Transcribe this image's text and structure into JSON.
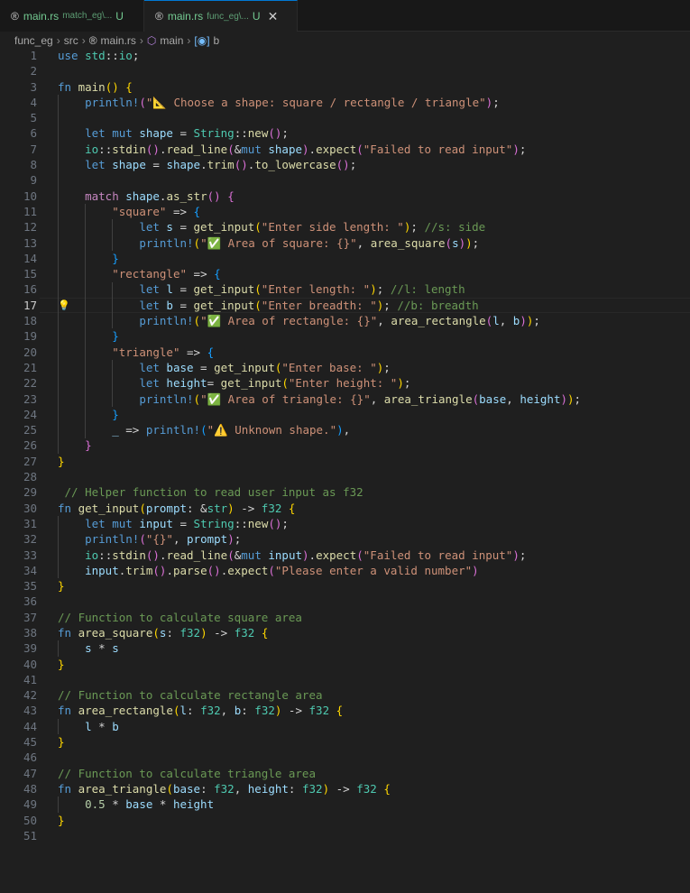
{
  "tabs": [
    {
      "icon": "rust-icon",
      "name": "main.rs",
      "desc": "match_eg\\...",
      "status": "U"
    },
    {
      "icon": "rust-icon",
      "name": "main.rs",
      "desc": "func_eg\\...",
      "status": "U",
      "close": "✕"
    }
  ],
  "breadcrumb": [
    "func_eg",
    "src",
    "main.rs",
    "main",
    "b"
  ],
  "current_line": 17,
  "code": [
    {
      "n": "1",
      "segs": [
        [
          "kw",
          "use "
        ],
        [
          "ty",
          "std"
        ],
        [
          "pl",
          "::"
        ],
        [
          "ty",
          "io"
        ],
        [
          "pl",
          ";"
        ]
      ]
    },
    {
      "n": "2",
      "segs": []
    },
    {
      "n": "3",
      "segs": [
        [
          "kw",
          "fn "
        ],
        [
          "fn",
          "main"
        ],
        [
          "br1",
          "()"
        ],
        [
          "pl",
          " "
        ],
        [
          "br1",
          "{"
        ]
      ]
    },
    {
      "n": "4",
      "segs": [
        [
          "pl",
          "    "
        ],
        [
          "mac",
          "println!"
        ],
        [
          "br2",
          "("
        ],
        [
          "str",
          "\"📐 Choose a shape: square / rectangle / triangle\""
        ],
        [
          "br2",
          ")"
        ],
        [
          "pl",
          ";"
        ]
      ]
    },
    {
      "n": "5",
      "segs": []
    },
    {
      "n": "6",
      "segs": [
        [
          "pl",
          "    "
        ],
        [
          "kw",
          "let mut "
        ],
        [
          "var",
          "shape"
        ],
        [
          "pl",
          " = "
        ],
        [
          "ty",
          "String"
        ],
        [
          "pl",
          "::"
        ],
        [
          "fn",
          "new"
        ],
        [
          "br2",
          "()"
        ],
        [
          "pl",
          ";"
        ]
      ]
    },
    {
      "n": "7",
      "segs": [
        [
          "pl",
          "    "
        ],
        [
          "ty",
          "io"
        ],
        [
          "pl",
          "::"
        ],
        [
          "fn",
          "stdin"
        ],
        [
          "br2",
          "()"
        ],
        [
          "pl",
          "."
        ],
        [
          "fn",
          "read_line"
        ],
        [
          "br2",
          "("
        ],
        [
          "pl",
          "&"
        ],
        [
          "kw",
          "mut "
        ],
        [
          "var",
          "shape"
        ],
        [
          "br2",
          ")"
        ],
        [
          "pl",
          "."
        ],
        [
          "fn",
          "expect"
        ],
        [
          "br2",
          "("
        ],
        [
          "str",
          "\"Failed to read input\""
        ],
        [
          "br2",
          ")"
        ],
        [
          "pl",
          ";"
        ]
      ]
    },
    {
      "n": "8",
      "segs": [
        [
          "pl",
          "    "
        ],
        [
          "kw",
          "let "
        ],
        [
          "var",
          "shape"
        ],
        [
          "pl",
          " = "
        ],
        [
          "var",
          "shape"
        ],
        [
          "pl",
          "."
        ],
        [
          "fn",
          "trim"
        ],
        [
          "br2",
          "()"
        ],
        [
          "pl",
          "."
        ],
        [
          "fn",
          "to_lowercase"
        ],
        [
          "br2",
          "()"
        ],
        [
          "pl",
          ";"
        ]
      ]
    },
    {
      "n": "9",
      "segs": []
    },
    {
      "n": "10",
      "segs": [
        [
          "pl",
          "    "
        ],
        [
          "ctrl",
          "match "
        ],
        [
          "var",
          "shape"
        ],
        [
          "pl",
          "."
        ],
        [
          "fn",
          "as_str"
        ],
        [
          "br2",
          "()"
        ],
        [
          "pl",
          " "
        ],
        [
          "br2",
          "{"
        ]
      ]
    },
    {
      "n": "11",
      "segs": [
        [
          "pl",
          "        "
        ],
        [
          "str",
          "\"square\""
        ],
        [
          "pl",
          " => "
        ],
        [
          "br3",
          "{"
        ]
      ]
    },
    {
      "n": "12",
      "segs": [
        [
          "pl",
          "            "
        ],
        [
          "kw",
          "let "
        ],
        [
          "var",
          "s"
        ],
        [
          "pl",
          " = "
        ],
        [
          "fn",
          "get_input"
        ],
        [
          "br1",
          "("
        ],
        [
          "str",
          "\"Enter side length: \""
        ],
        [
          "br1",
          ")"
        ],
        [
          "pl",
          "; "
        ],
        [
          "cm",
          "//s: side"
        ]
      ]
    },
    {
      "n": "13",
      "segs": [
        [
          "pl",
          "            "
        ],
        [
          "mac",
          "println!"
        ],
        [
          "br1",
          "("
        ],
        [
          "str",
          "\"✅ Area of square: {}\""
        ],
        [
          "pl",
          ", "
        ],
        [
          "fn",
          "area_square"
        ],
        [
          "br2",
          "("
        ],
        [
          "var",
          "s"
        ],
        [
          "br2",
          ")"
        ],
        [
          "br1",
          ")"
        ],
        [
          "pl",
          ";"
        ]
      ]
    },
    {
      "n": "14",
      "segs": [
        [
          "pl",
          "        "
        ],
        [
          "br3",
          "}"
        ]
      ]
    },
    {
      "n": "15",
      "segs": [
        [
          "pl",
          "        "
        ],
        [
          "str",
          "\"rectangle\""
        ],
        [
          "pl",
          " => "
        ],
        [
          "br3",
          "{"
        ]
      ]
    },
    {
      "n": "16",
      "segs": [
        [
          "pl",
          "            "
        ],
        [
          "kw",
          "let "
        ],
        [
          "var",
          "l"
        ],
        [
          "pl",
          " = "
        ],
        [
          "fn",
          "get_input"
        ],
        [
          "br1",
          "("
        ],
        [
          "str",
          "\"Enter length: \""
        ],
        [
          "br1",
          ")"
        ],
        [
          "pl",
          "; "
        ],
        [
          "cm",
          "//l: length"
        ]
      ]
    },
    {
      "n": "17",
      "segs": [
        [
          "pl",
          "            "
        ],
        [
          "kw",
          "let "
        ],
        [
          "var",
          "b"
        ],
        [
          "pl",
          " = "
        ],
        [
          "fn",
          "get_input"
        ],
        [
          "br1",
          "("
        ],
        [
          "str",
          "\"Enter breadth: \""
        ],
        [
          "br1",
          ")"
        ],
        [
          "pl",
          "; "
        ],
        [
          "cm",
          "//b: breadth"
        ]
      ]
    },
    {
      "n": "18",
      "segs": [
        [
          "pl",
          "            "
        ],
        [
          "mac",
          "println!"
        ],
        [
          "br1",
          "("
        ],
        [
          "str",
          "\"✅ Area of rectangle: {}\""
        ],
        [
          "pl",
          ", "
        ],
        [
          "fn",
          "area_rectangle"
        ],
        [
          "br2",
          "("
        ],
        [
          "var",
          "l"
        ],
        [
          "pl",
          ", "
        ],
        [
          "var",
          "b"
        ],
        [
          "br2",
          ")"
        ],
        [
          "br1",
          ")"
        ],
        [
          "pl",
          ";"
        ]
      ]
    },
    {
      "n": "19",
      "segs": [
        [
          "pl",
          "        "
        ],
        [
          "br3",
          "}"
        ]
      ]
    },
    {
      "n": "20",
      "segs": [
        [
          "pl",
          "        "
        ],
        [
          "str",
          "\"triangle\""
        ],
        [
          "pl",
          " => "
        ],
        [
          "br3",
          "{"
        ]
      ]
    },
    {
      "n": "21",
      "segs": [
        [
          "pl",
          "            "
        ],
        [
          "kw",
          "let "
        ],
        [
          "var",
          "base"
        ],
        [
          "pl",
          " = "
        ],
        [
          "fn",
          "get_input"
        ],
        [
          "br1",
          "("
        ],
        [
          "str",
          "\"Enter base: \""
        ],
        [
          "br1",
          ")"
        ],
        [
          "pl",
          ";"
        ]
      ]
    },
    {
      "n": "22",
      "segs": [
        [
          "pl",
          "            "
        ],
        [
          "kw",
          "let "
        ],
        [
          "var",
          "height"
        ],
        [
          "pl",
          "= "
        ],
        [
          "fn",
          "get_input"
        ],
        [
          "br1",
          "("
        ],
        [
          "str",
          "\"Enter height: \""
        ],
        [
          "br1",
          ")"
        ],
        [
          "pl",
          ";"
        ]
      ]
    },
    {
      "n": "23",
      "segs": [
        [
          "pl",
          "            "
        ],
        [
          "mac",
          "println!"
        ],
        [
          "br1",
          "("
        ],
        [
          "str",
          "\"✅ Area of triangle: {}\""
        ],
        [
          "pl",
          ", "
        ],
        [
          "fn",
          "area_triangle"
        ],
        [
          "br2",
          "("
        ],
        [
          "var",
          "base"
        ],
        [
          "pl",
          ", "
        ],
        [
          "var",
          "height"
        ],
        [
          "br2",
          ")"
        ],
        [
          "br1",
          ")"
        ],
        [
          "pl",
          ";"
        ]
      ]
    },
    {
      "n": "24",
      "segs": [
        [
          "pl",
          "        "
        ],
        [
          "br3",
          "}"
        ]
      ]
    },
    {
      "n": "25",
      "segs": [
        [
          "pl",
          "        "
        ],
        [
          "var",
          "_"
        ],
        [
          "pl",
          " => "
        ],
        [
          "mac",
          "println!"
        ],
        [
          "br3",
          "("
        ],
        [
          "str",
          "\"⚠️ Unknown shape.\""
        ],
        [
          "br3",
          ")"
        ],
        [
          "pl",
          ","
        ]
      ]
    },
    {
      "n": "26",
      "segs": [
        [
          "pl",
          "    "
        ],
        [
          "br2",
          "}"
        ]
      ]
    },
    {
      "n": "27",
      "segs": [
        [
          "br1",
          "}"
        ]
      ]
    },
    {
      "n": "28",
      "segs": []
    },
    {
      "n": "29",
      "segs": [
        [
          "pl",
          " "
        ],
        [
          "cm",
          "// Helper function to read user input as f32"
        ]
      ]
    },
    {
      "n": "30",
      "segs": [
        [
          "kw",
          "fn "
        ],
        [
          "fn",
          "get_input"
        ],
        [
          "br1",
          "("
        ],
        [
          "var",
          "prompt"
        ],
        [
          "pl",
          ": &"
        ],
        [
          "ty",
          "str"
        ],
        [
          "br1",
          ")"
        ],
        [
          "pl",
          " -> "
        ],
        [
          "ty",
          "f32"
        ],
        [
          "pl",
          " "
        ],
        [
          "br1",
          "{"
        ]
      ]
    },
    {
      "n": "31",
      "segs": [
        [
          "pl",
          "    "
        ],
        [
          "kw",
          "let mut "
        ],
        [
          "var",
          "input"
        ],
        [
          "pl",
          " = "
        ],
        [
          "ty",
          "String"
        ],
        [
          "pl",
          "::"
        ],
        [
          "fn",
          "new"
        ],
        [
          "br2",
          "()"
        ],
        [
          "pl",
          ";"
        ]
      ]
    },
    {
      "n": "32",
      "segs": [
        [
          "pl",
          "    "
        ],
        [
          "mac",
          "println!"
        ],
        [
          "br2",
          "("
        ],
        [
          "str",
          "\"{}\""
        ],
        [
          "pl",
          ", "
        ],
        [
          "var",
          "prompt"
        ],
        [
          "br2",
          ")"
        ],
        [
          "pl",
          ";"
        ]
      ]
    },
    {
      "n": "33",
      "segs": [
        [
          "pl",
          "    "
        ],
        [
          "ty",
          "io"
        ],
        [
          "pl",
          "::"
        ],
        [
          "fn",
          "stdin"
        ],
        [
          "br2",
          "()"
        ],
        [
          "pl",
          "."
        ],
        [
          "fn",
          "read_line"
        ],
        [
          "br2",
          "("
        ],
        [
          "pl",
          "&"
        ],
        [
          "kw",
          "mut "
        ],
        [
          "var",
          "input"
        ],
        [
          "br2",
          ")"
        ],
        [
          "pl",
          "."
        ],
        [
          "fn",
          "expect"
        ],
        [
          "br2",
          "("
        ],
        [
          "str",
          "\"Failed to read input\""
        ],
        [
          "br2",
          ")"
        ],
        [
          "pl",
          ";"
        ]
      ]
    },
    {
      "n": "34",
      "segs": [
        [
          "pl",
          "    "
        ],
        [
          "var",
          "input"
        ],
        [
          "pl",
          "."
        ],
        [
          "fn",
          "trim"
        ],
        [
          "br2",
          "()"
        ],
        [
          "pl",
          "."
        ],
        [
          "fn",
          "parse"
        ],
        [
          "br2",
          "()"
        ],
        [
          "pl",
          "."
        ],
        [
          "fn",
          "expect"
        ],
        [
          "br2",
          "("
        ],
        [
          "str",
          "\"Please enter a valid number\""
        ],
        [
          "br2",
          ")"
        ]
      ]
    },
    {
      "n": "35",
      "segs": [
        [
          "br1",
          "}"
        ]
      ]
    },
    {
      "n": "36",
      "segs": []
    },
    {
      "n": "37",
      "segs": [
        [
          "cm",
          "// Function to calculate square area"
        ]
      ]
    },
    {
      "n": "38",
      "segs": [
        [
          "kw",
          "fn "
        ],
        [
          "fn",
          "area_square"
        ],
        [
          "br1",
          "("
        ],
        [
          "var",
          "s"
        ],
        [
          "pl",
          ": "
        ],
        [
          "ty",
          "f32"
        ],
        [
          "br1",
          ")"
        ],
        [
          "pl",
          " -> "
        ],
        [
          "ty",
          "f32"
        ],
        [
          "pl",
          " "
        ],
        [
          "br1",
          "{"
        ]
      ]
    },
    {
      "n": "39",
      "segs": [
        [
          "pl",
          "    "
        ],
        [
          "var",
          "s"
        ],
        [
          "pl",
          " * "
        ],
        [
          "var",
          "s"
        ]
      ]
    },
    {
      "n": "40",
      "segs": [
        [
          "br1",
          "}"
        ]
      ]
    },
    {
      "n": "41",
      "segs": []
    },
    {
      "n": "42",
      "segs": [
        [
          "cm",
          "// Function to calculate rectangle area"
        ]
      ]
    },
    {
      "n": "43",
      "segs": [
        [
          "kw",
          "fn "
        ],
        [
          "fn",
          "area_rectangle"
        ],
        [
          "br1",
          "("
        ],
        [
          "var",
          "l"
        ],
        [
          "pl",
          ": "
        ],
        [
          "ty",
          "f32"
        ],
        [
          "pl",
          ", "
        ],
        [
          "var",
          "b"
        ],
        [
          "pl",
          ": "
        ],
        [
          "ty",
          "f32"
        ],
        [
          "br1",
          ")"
        ],
        [
          "pl",
          " -> "
        ],
        [
          "ty",
          "f32"
        ],
        [
          "pl",
          " "
        ],
        [
          "br1",
          "{"
        ]
      ]
    },
    {
      "n": "44",
      "segs": [
        [
          "pl",
          "    "
        ],
        [
          "var",
          "l"
        ],
        [
          "pl",
          " * "
        ],
        [
          "var",
          "b"
        ]
      ]
    },
    {
      "n": "45",
      "segs": [
        [
          "br1",
          "}"
        ]
      ]
    },
    {
      "n": "46",
      "segs": []
    },
    {
      "n": "47",
      "segs": [
        [
          "cm",
          "// Function to calculate triangle area"
        ]
      ]
    },
    {
      "n": "48",
      "segs": [
        [
          "kw",
          "fn "
        ],
        [
          "fn",
          "area_triangle"
        ],
        [
          "br1",
          "("
        ],
        [
          "var",
          "base"
        ],
        [
          "pl",
          ": "
        ],
        [
          "ty",
          "f32"
        ],
        [
          "pl",
          ", "
        ],
        [
          "var",
          "height"
        ],
        [
          "pl",
          ": "
        ],
        [
          "ty",
          "f32"
        ],
        [
          "br1",
          ")"
        ],
        [
          "pl",
          " -> "
        ],
        [
          "ty",
          "f32"
        ],
        [
          "pl",
          " "
        ],
        [
          "br1",
          "{"
        ]
      ]
    },
    {
      "n": "49",
      "segs": [
        [
          "pl",
          "    "
        ],
        [
          "num",
          "0.5"
        ],
        [
          "pl",
          " * "
        ],
        [
          "var",
          "base"
        ],
        [
          "pl",
          " * "
        ],
        [
          "var",
          "height"
        ]
      ]
    },
    {
      "n": "50",
      "segs": [
        [
          "br1",
          "}"
        ]
      ]
    },
    {
      "n": "51",
      "segs": []
    }
  ]
}
